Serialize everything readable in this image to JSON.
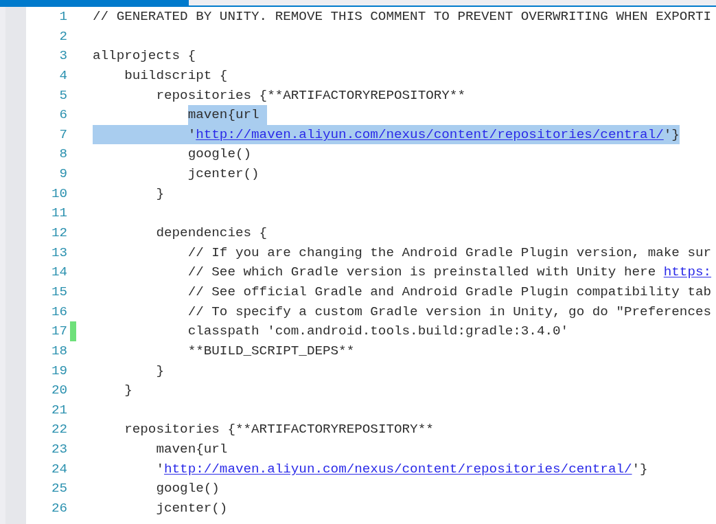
{
  "tabs": [
    {
      "selected": true
    }
  ],
  "lines": [
    {
      "number": "1",
      "selected": false,
      "changed": false,
      "code": [
        {
          "kind": "text",
          "text": "// GENERATED BY UNITY. REMOVE THIS COMMENT TO PREVENT OVERWRITING WHEN EXPORTI"
        }
      ]
    },
    {
      "number": "2",
      "selected": false,
      "changed": false
    },
    {
      "number": "3",
      "selected": false,
      "changed": false,
      "code": [
        {
          "kind": "text",
          "text": "allprojects {"
        }
      ]
    },
    {
      "number": "4",
      "selected": false,
      "changed": false,
      "code": [
        {
          "kind": "text",
          "text": "    buildscript {"
        }
      ]
    },
    {
      "number": "5",
      "selected": false,
      "changed": false,
      "code": [
        {
          "kind": "text",
          "text": "        repositories {**ARTIFACTORYREPOSITORY**"
        }
      ]
    },
    {
      "number": "6",
      "selected": true,
      "changed": false,
      "code": [
        {
          "kind": "text",
          "text": "            maven{url"
        }
      ]
    },
    {
      "number": "7",
      "selected": true,
      "changed": false,
      "code": [
        {
          "kind": "text",
          "text": "            '"
        },
        {
          "kind": "link",
          "text": "http://maven.aliyun.com/nexus/content/repositories/central/"
        },
        {
          "kind": "text",
          "text": "'}"
        }
      ]
    },
    {
      "number": "8",
      "selected": false,
      "changed": false,
      "code": [
        {
          "kind": "text",
          "text": "            google()"
        }
      ]
    },
    {
      "number": "9",
      "selected": false,
      "changed": false,
      "code": [
        {
          "kind": "text",
          "text": "            jcenter()"
        }
      ]
    },
    {
      "number": "10",
      "selected": false,
      "changed": false,
      "code": [
        {
          "kind": "text",
          "text": "        }"
        }
      ]
    },
    {
      "number": "11",
      "selected": false,
      "changed": false
    },
    {
      "number": "12",
      "selected": false,
      "changed": false,
      "code": [
        {
          "kind": "text",
          "text": "        dependencies {"
        }
      ]
    },
    {
      "number": "13",
      "selected": false,
      "changed": false,
      "code": [
        {
          "kind": "text",
          "text": "            // If you are changing the Android Gradle Plugin version, make sur"
        }
      ]
    },
    {
      "number": "14",
      "selected": false,
      "changed": false,
      "code": [
        {
          "kind": "text",
          "text": "            // See which Gradle version is preinstalled with Unity here"
        },
        {
          "kind": "link",
          "text": "https:"
        }
      ]
    },
    {
      "number": "15",
      "selected": false,
      "changed": false,
      "code": [
        {
          "kind": "text",
          "text": "            // See official Gradle and Android Gradle Plugin compatibility tab"
        }
      ]
    },
    {
      "number": "16",
      "selected": false,
      "changed": false,
      "code": [
        {
          "kind": "text",
          "text": "            // To specify a custom Gradle version in Unity, go do \"Preferences"
        }
      ]
    },
    {
      "number": "17",
      "selected": false,
      "changed": true,
      "code": [
        {
          "kind": "text",
          "text": "            classpath 'com.android.tools.build:gradle:3.4.0'"
        }
      ]
    },
    {
      "number": "18",
      "selected": false,
      "changed": false,
      "code": [
        {
          "kind": "text",
          "text": "            **BUILD_SCRIPT_DEPS**"
        }
      ]
    },
    {
      "number": "19",
      "selected": false,
      "changed": false,
      "code": [
        {
          "kind": "text",
          "text": "        }"
        }
      ]
    },
    {
      "number": "20",
      "selected": false,
      "changed": false,
      "code": [
        {
          "kind": "text",
          "text": "    }"
        }
      ]
    },
    {
      "number": "21",
      "selected": false,
      "changed": false
    },
    {
      "number": "22",
      "selected": false,
      "changed": false,
      "code": [
        {
          "kind": "text",
          "text": "    repositories {**ARTIFACTORYREPOSITORY**"
        }
      ]
    },
    {
      "number": "23",
      "selected": false,
      "changed": false,
      "code": [
        {
          "kind": "text",
          "text": "        maven{url"
        }
      ]
    },
    {
      "number": "24",
      "selected": false,
      "changed": false,
      "code": [
        {
          "kind": "text",
          "text": "        '"
        },
        {
          "kind": "link",
          "text": "http://maven.aliyun.com/nexus/content/repositories/central/"
        },
        {
          "kind": "text",
          "text": "'}"
        }
      ]
    },
    {
      "number": "25",
      "selected": false,
      "changed": false,
      "code": [
        {
          "kind": "text",
          "text": "        google()"
        }
      ]
    },
    {
      "number": "26",
      "selected": false,
      "changed": false,
      "code": [
        {
          "kind": "text",
          "text": "        jcenter()"
        }
      ]
    }
  ]
}
